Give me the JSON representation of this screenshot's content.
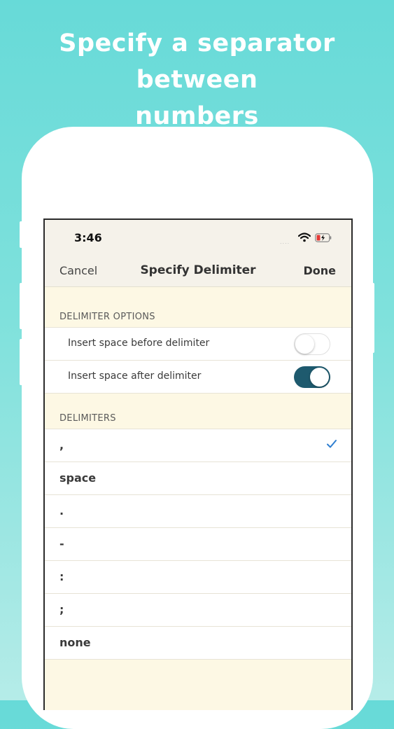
{
  "headline": {
    "line1": "Specify a separator between",
    "line2": "numbers"
  },
  "status_bar": {
    "time": "3:46",
    "signal": "....",
    "icons": [
      "wifi-icon",
      "battery-charging-icon"
    ]
  },
  "nav": {
    "cancel": "Cancel",
    "title": "Specify Delimiter",
    "done": "Done"
  },
  "options": {
    "header": "DELIMITER OPTIONS",
    "items": [
      {
        "label": "Insert space before delimiter",
        "enabled": false
      },
      {
        "label": "Insert space after delimiter",
        "enabled": true
      }
    ]
  },
  "delimiters": {
    "header": "DELIMITERS",
    "items": [
      {
        "label": ",",
        "selected": true
      },
      {
        "label": "space",
        "selected": false
      },
      {
        "label": ".",
        "selected": false
      },
      {
        "label": "-",
        "selected": false
      },
      {
        "label": ":",
        "selected": false
      },
      {
        "label": ";",
        "selected": false
      },
      {
        "label": "none",
        "selected": false
      }
    ]
  },
  "colors": {
    "background_top": "#67dad8",
    "background_bottom": "#b5ece8",
    "screen_bg": "#fdf8e4",
    "toggle_on": "#1e5a6e",
    "checkmark": "#2f7fd1"
  }
}
